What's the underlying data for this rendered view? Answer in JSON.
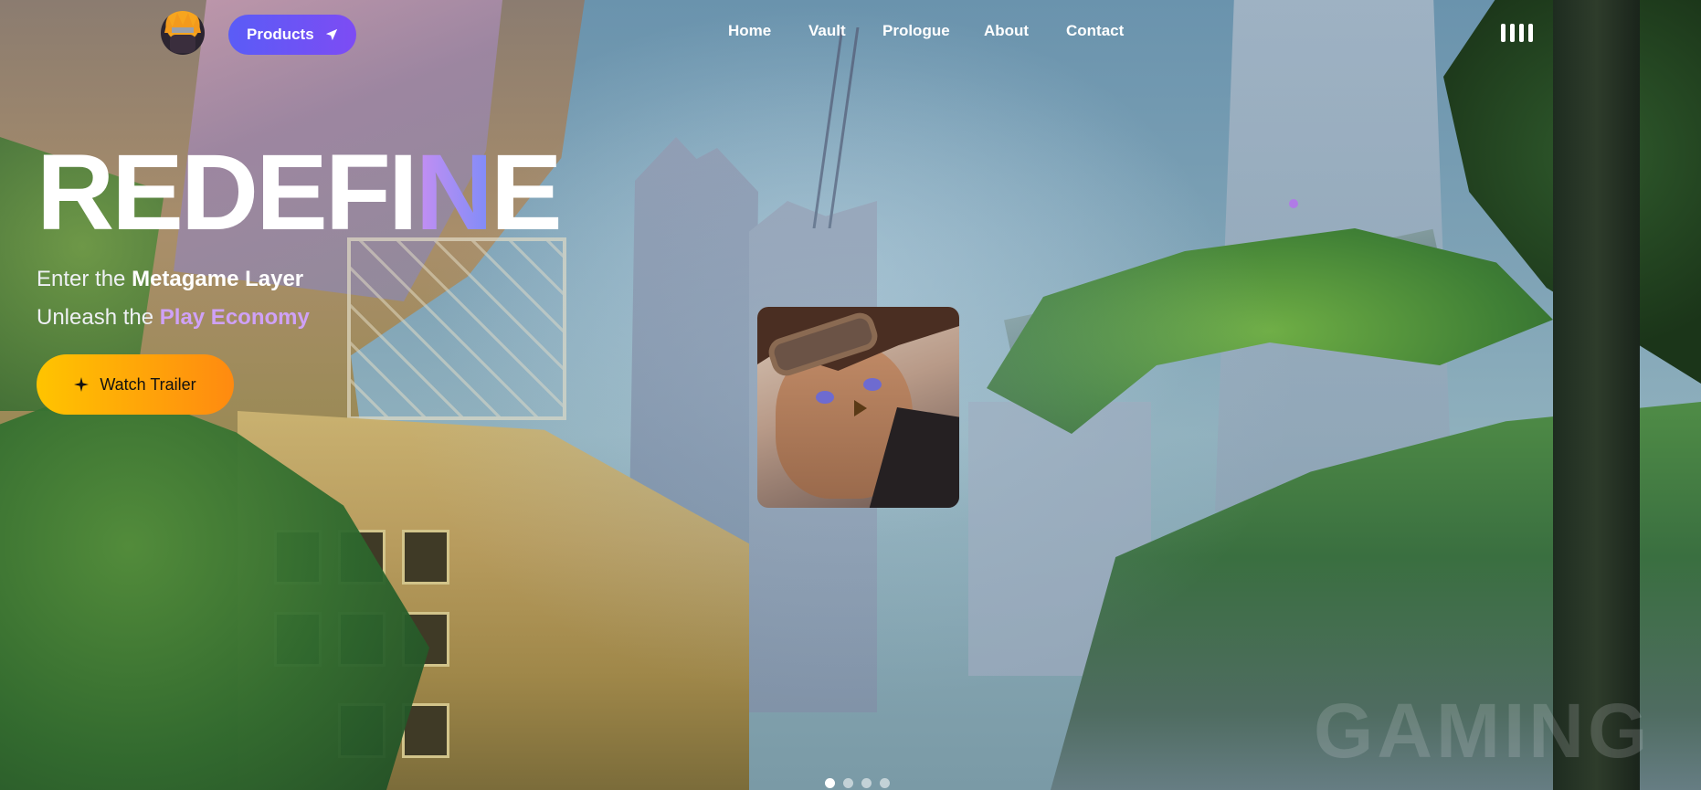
{
  "nav": {
    "products_label": "Products",
    "links": [
      "Home",
      "Vault",
      "Prologue",
      "About",
      "Contact"
    ]
  },
  "hero": {
    "title_main": "REDEFI",
    "title_accent": "N",
    "title_tail": "E",
    "line1_prefix": "Enter the ",
    "line1_bold": "Metagame Layer",
    "line2_prefix": "Unleash the ",
    "line2_accent": "Play Economy",
    "cta_label": "Watch Trailer"
  },
  "watermark": "GAMING",
  "pager": {
    "count": 4,
    "active_index": 0
  },
  "icons": {
    "logo": "ninja-avatar-icon",
    "products": "send-icon",
    "cta": "sparkle-icon",
    "audio": "audio-bars-icon"
  },
  "colors": {
    "products_gradient": [
      "#5a5cf6",
      "#7d4cf4"
    ],
    "cta_gradient": [
      "#ffc400",
      "#ff8a10"
    ],
    "accent_purple": "#cfa1f7"
  }
}
